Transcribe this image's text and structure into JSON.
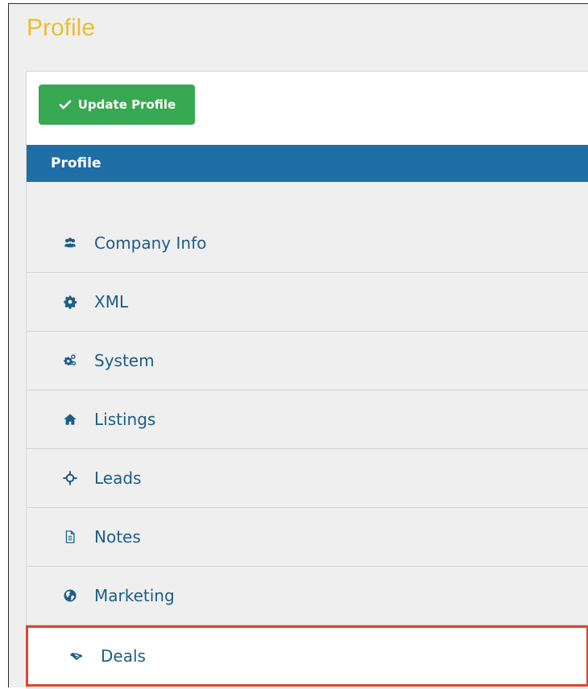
{
  "page": {
    "title": "Profile",
    "title_color": "#ebbd33"
  },
  "toolbar": {
    "update_label": "Update Profile",
    "update_icon": "check-icon",
    "button_color": "#38a852"
  },
  "panel": {
    "header": "Profile",
    "header_color": "#1f6ea6"
  },
  "sidebar": {
    "items": [
      {
        "label": "Company Info",
        "icon": "users-icon",
        "active": false
      },
      {
        "label": "XML",
        "icon": "gear-icon",
        "active": false
      },
      {
        "label": "System",
        "icon": "gears-icon",
        "active": false
      },
      {
        "label": "Listings",
        "icon": "home-icon",
        "active": false
      },
      {
        "label": "Leads",
        "icon": "crosshair-icon",
        "active": false
      },
      {
        "label": "Notes",
        "icon": "document-icon",
        "active": false
      },
      {
        "label": "Marketing",
        "icon": "globe-icon",
        "active": false
      },
      {
        "label": "Deals",
        "icon": "handshake-icon",
        "active": true
      }
    ]
  },
  "colors": {
    "menu_text": "#1d5d85",
    "active_outline": "#e0442f",
    "menu_background": "#efefef"
  }
}
